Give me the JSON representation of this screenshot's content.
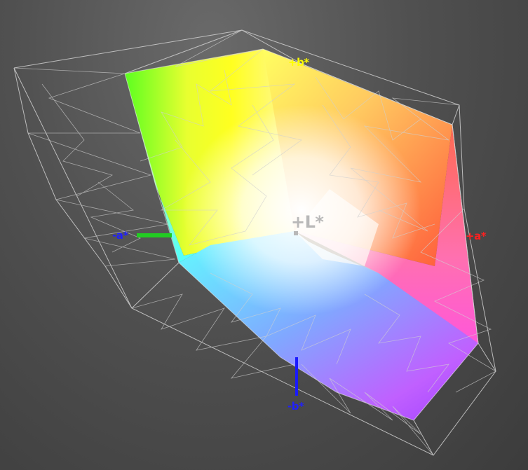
{
  "axes": {
    "b_plus": {
      "text": "+b*",
      "color": "#ffff00"
    },
    "a_minus": {
      "text": "-a*",
      "color": "#2020ff"
    },
    "a_plus": {
      "text": "+a*",
      "color": "#ff2020"
    },
    "b_minus": {
      "text": "-b*",
      "color": "#2020ff"
    },
    "l_plus": {
      "text": "+L*",
      "color": "#b8b8b8"
    }
  },
  "colors": {
    "background": "#4a4a4a",
    "wireframe": "#d0d0d0",
    "a_minus_axis": "#22cc22",
    "b_minus_axis": "#1a1aff"
  }
}
